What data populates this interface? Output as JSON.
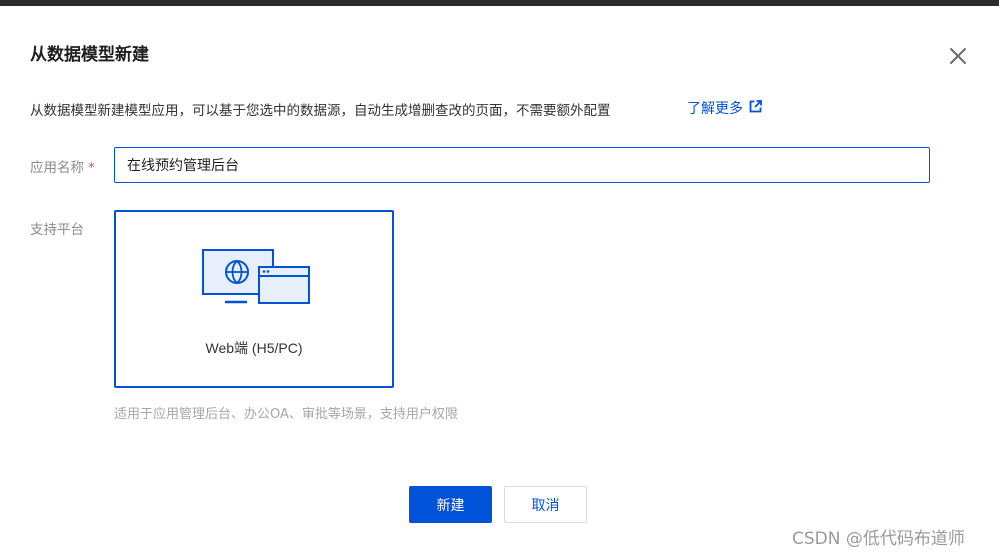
{
  "dialog": {
    "title": "从数据模型新建",
    "description": "从数据模型新建模型应用，可以基于您选中的数据源，自动生成增删查改的页面，不需要额外配置",
    "learn_more": "了解更多"
  },
  "form": {
    "name_label": "应用名称",
    "required_mark": "*",
    "name_value": "在线预约管理后台",
    "platform_label": "支持平台",
    "platform_option": "Web端 (H5/PC)",
    "platform_hint": "适用于应用管理后台、办公OA、审批等场景，支持用户权限"
  },
  "buttons": {
    "create": "新建",
    "cancel": "取消"
  },
  "watermark": "CSDN @低代码布道师",
  "colors": {
    "primary": "#0052d9",
    "required": "#e34d59",
    "text_secondary": "#8c8c8c"
  },
  "icons": {
    "close": "close-icon",
    "external_link": "external-link-icon",
    "platform": "web-platform-icon"
  }
}
